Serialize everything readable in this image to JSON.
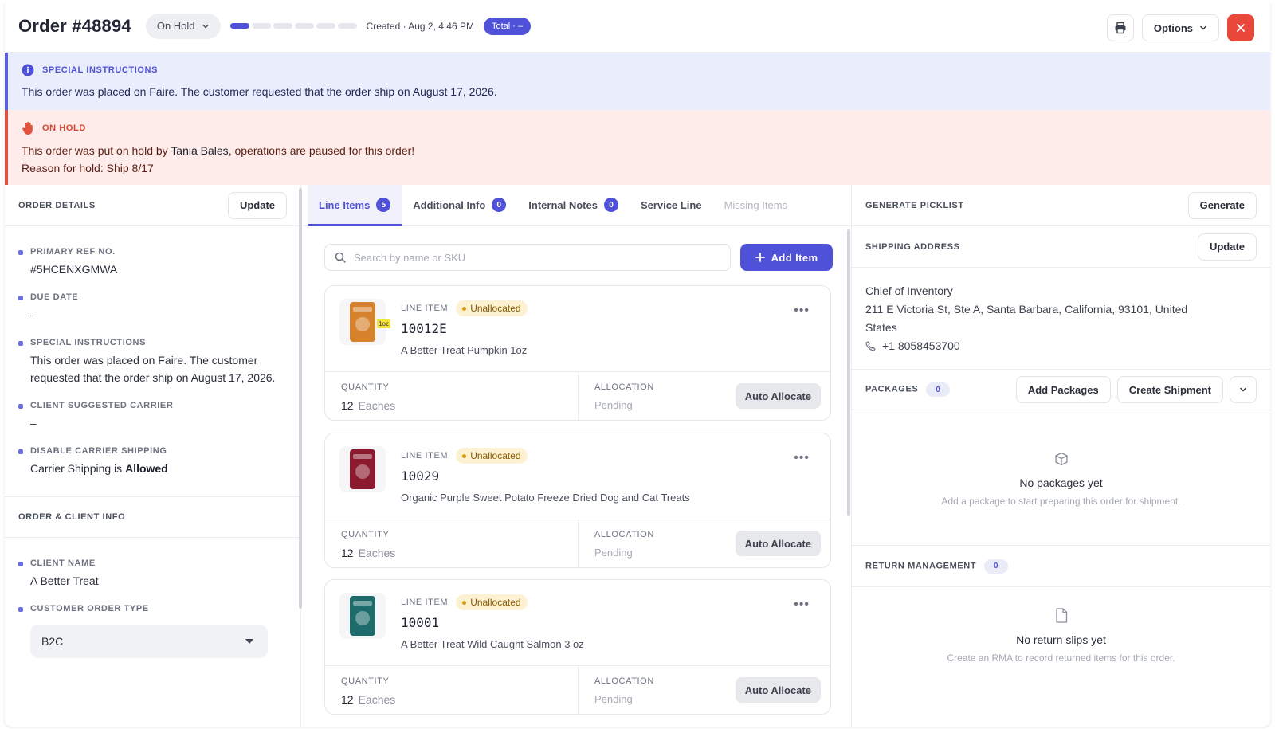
{
  "header": {
    "order_title": "Order #48894",
    "status": "On Hold",
    "progress_segments": 6,
    "progress_completed": 1,
    "created": "Created · Aug 2, 4:46 PM",
    "total": "Total · –",
    "options_label": "Options"
  },
  "banners": {
    "info": {
      "title": "SPECIAL INSTRUCTIONS",
      "text": "This order was placed on Faire. The customer requested that the order ship on August 17, 2026."
    },
    "hold": {
      "title": "ON HOLD",
      "text_before": "This order was put on hold by ",
      "user": "Tania Bales",
      "text_after": ", operations are paused for this order!",
      "reason": "Reason for hold: Ship 8/17"
    }
  },
  "order_details": {
    "title": "ORDER DETAILS",
    "update_label": "Update",
    "fields": [
      {
        "label": "PRIMARY REF NO.",
        "value": "#5HCENXGMWA"
      },
      {
        "label": "DUE DATE",
        "value": "–"
      },
      {
        "label": "SPECIAL INSTRUCTIONS",
        "value": "This order was placed on Faire. The customer requested that the order ship on August 17, 2026."
      },
      {
        "label": "CLIENT SUGGESTED CARRIER",
        "value": "–"
      },
      {
        "label": "DISABLE CARRIER SHIPPING",
        "value_prefix": "Carrier Shipping is ",
        "value_bold": "Allowed"
      }
    ]
  },
  "order_client_info": {
    "title": "ORDER & CLIENT INFO",
    "client_name_label": "CLIENT NAME",
    "client_name": "A Better Treat",
    "order_type_label": "CUSTOMER ORDER TYPE",
    "order_type": "B2C"
  },
  "tabs": [
    {
      "label": "Line Items",
      "count": "5"
    },
    {
      "label": "Additional Info",
      "count": "0"
    },
    {
      "label": "Internal Notes",
      "count": "0"
    },
    {
      "label": "Service Line"
    },
    {
      "label": "Missing Items"
    }
  ],
  "line_items": {
    "search_placeholder": "Search by name or SKU",
    "add_label": "Add Item",
    "line_item_label": "LINE ITEM",
    "quantity_label": "QUANTITY",
    "allocation_label": "ALLOCATION",
    "auto_allocate_label": "Auto Allocate",
    "items": [
      {
        "status": "Unallocated",
        "sku": "10012E",
        "name": "A Better Treat Pumpkin 1oz",
        "qty": "12",
        "unit": "Eaches",
        "allocation": "Pending",
        "thumb_color": "#d6822c",
        "thumb_badge": "1oz"
      },
      {
        "status": "Unallocated",
        "sku": "10029",
        "name": "Organic Purple Sweet Potato Freeze Dried Dog and Cat Treats",
        "qty": "12",
        "unit": "Eaches",
        "allocation": "Pending",
        "thumb_color": "#8b1a2e"
      },
      {
        "status": "Unallocated",
        "sku": "10001",
        "name": "A Better Treat Wild Caught Salmon 3 oz",
        "qty": "12",
        "unit": "Eaches",
        "allocation": "Pending",
        "thumb_color": "#1d6b6b"
      }
    ]
  },
  "picklist": {
    "title": "GENERATE PICKLIST",
    "button": "Generate"
  },
  "shipping": {
    "title": "SHIPPING ADDRESS",
    "button": "Update",
    "name": "Chief of Inventory",
    "address": "211 E Victoria St, Ste A, Santa Barbara, California, 93101, United States",
    "phone": "+1 8058453700"
  },
  "packages": {
    "title": "PACKAGES",
    "count": "0",
    "add_label": "Add Packages",
    "create_label": "Create Shipment",
    "empty_title": "No packages yet",
    "empty_text": "Add a package to start preparing this order for shipment."
  },
  "returns": {
    "title": "RETURN MANAGEMENT",
    "count": "0",
    "empty_title": "No return slips yet",
    "empty_text": "Create an RMA to record returned items for this order."
  },
  "colors": {
    "accent": "#4f51d8",
    "danger": "#e8473a",
    "hold_bg": "#fdecea",
    "info_bg": "#eaedfc"
  }
}
